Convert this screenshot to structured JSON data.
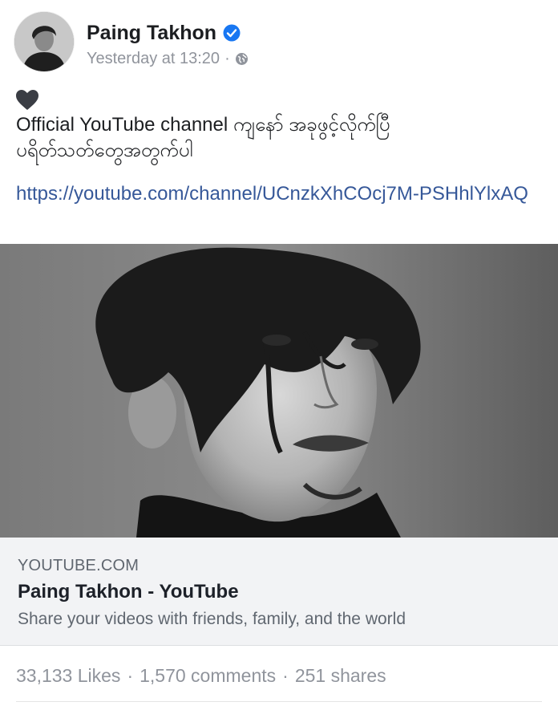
{
  "post": {
    "author": "Paing Takhon",
    "timestamp": "Yesterday at 13:20",
    "separator": "·",
    "text_lines": [
      "Official YouTube channel ကျနော် အခုဖွင့်လိုက်ပြီ",
      "ပရိတ်သတ်တွေအတွက်ပါ"
    ],
    "link": "https://youtube.com/channel/UCnzkXhCOcj7M-PSHhlYlxAQ",
    "icons": {
      "verified": "verified-badge-icon",
      "audience": "globe-icon",
      "emoji": "black-heart-icon"
    }
  },
  "link_card": {
    "domain": "YOUTUBE.COM",
    "title": "Paing Takhon - YouTube",
    "description": "Share your videos with friends, family, and the world"
  },
  "stats": {
    "likes": "33,133 Likes",
    "comments": "1,570 comments",
    "shares": "251 shares",
    "separator": "·"
  },
  "colors": {
    "link": "#365899",
    "verified": "#1877f2",
    "muted": "#90949c",
    "card_bg": "#f2f3f5"
  }
}
